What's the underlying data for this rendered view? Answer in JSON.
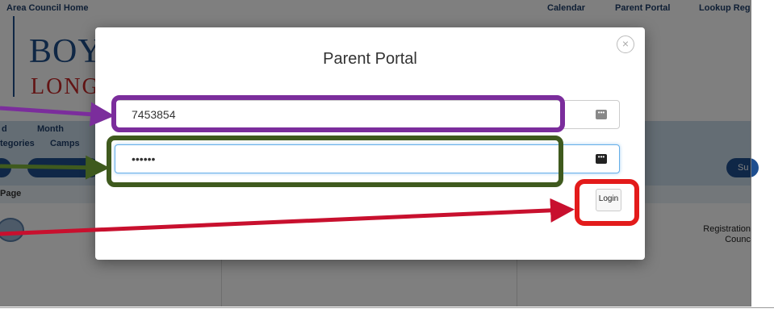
{
  "topbar": {
    "home": "Area Council Home",
    "nav": [
      "Calendar",
      "Parent Portal",
      "Lookup Reg"
    ]
  },
  "logo": {
    "line1": "BOY",
    "line2": "LONG"
  },
  "background": {
    "left_labels": [
      "d",
      "Month",
      "tegories",
      "Camps",
      "Page"
    ],
    "right_button": "Su",
    "registration": [
      "Registration",
      "Counc"
    ]
  },
  "modal": {
    "title": "Parent Portal",
    "username_value": "7453854",
    "password_value": "••••••",
    "login_label": "Login",
    "close_symbol": "×"
  },
  "colors": {
    "purple": "#7b2d9c",
    "green": "#3f5a1e",
    "red": "#e31b1b"
  }
}
